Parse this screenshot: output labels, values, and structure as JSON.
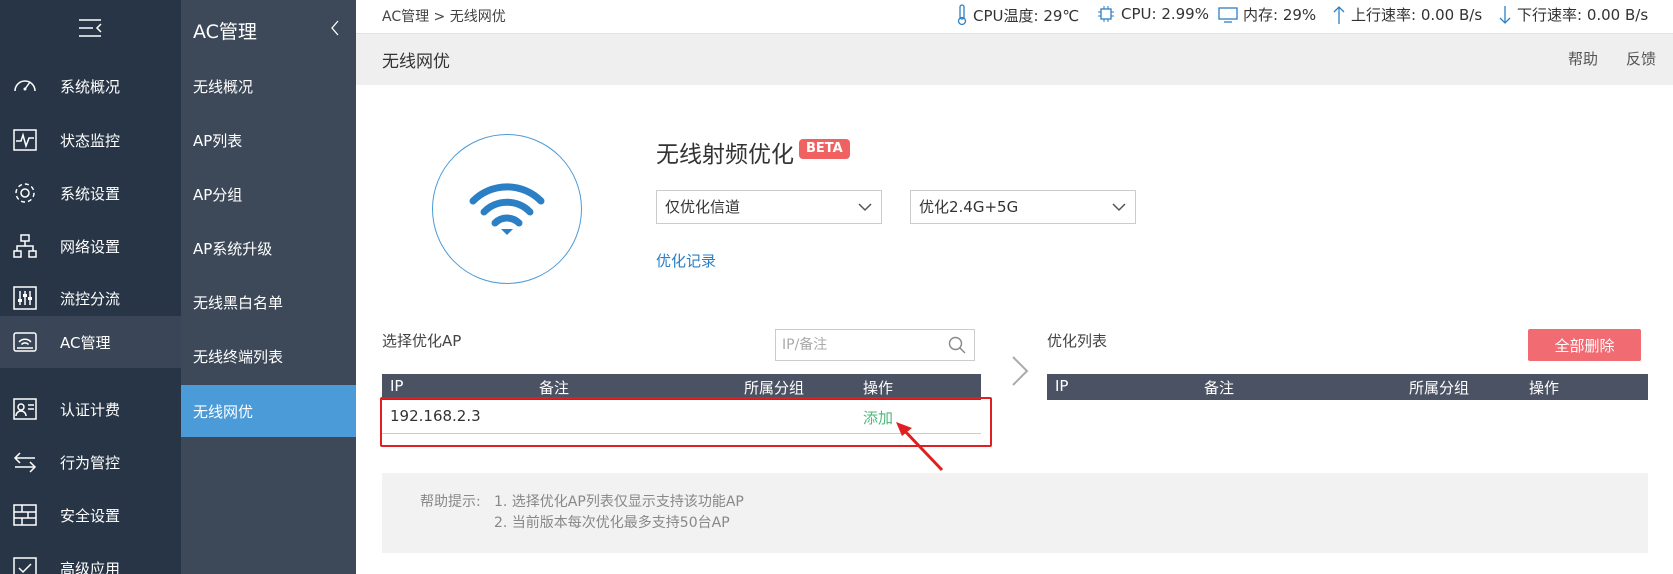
{
  "sidebar": {
    "items": [
      {
        "label": "系统概况",
        "icon": "dashboard-icon"
      },
      {
        "label": "状态监控",
        "icon": "monitor-icon"
      },
      {
        "label": "系统设置",
        "icon": "gear-icon"
      },
      {
        "label": "网络设置",
        "icon": "network-icon"
      },
      {
        "label": "流控分流",
        "icon": "sliders-icon"
      },
      {
        "label": "AC管理",
        "icon": "router-icon"
      },
      {
        "label": "认证计费",
        "icon": "id-card-icon"
      },
      {
        "label": "行为管控",
        "icon": "swap-icon"
      },
      {
        "label": "安全设置",
        "icon": "firewall-icon"
      },
      {
        "label": "高级应用",
        "icon": "check-box-icon"
      }
    ]
  },
  "submenu": {
    "title": "AC管理",
    "items": [
      "无线概况",
      "AP列表",
      "AP分组",
      "AP系统升级",
      "无线黑白名单",
      "无线终端列表",
      "无线网优"
    ]
  },
  "topbar": {
    "breadcrumb": "AC管理 > 无线网优",
    "cpu_temp": "CPU温度: 29℃",
    "cpu": "CPU: 2.99%",
    "memory": "内存: 29%",
    "upload": "上行速率: 0.00 B/s",
    "download": "下行速率: 0.00 B/s"
  },
  "titlebar": {
    "title": "无线网优",
    "help": "帮助",
    "feedback": "反馈"
  },
  "optimize": {
    "title": "无线射频优化",
    "badge": "BETA",
    "mode_select": "仅优化信道",
    "band_select": "优化2.4G+5G",
    "record_link": "优化记录"
  },
  "select_ap": {
    "label": "选择优化AP",
    "search_placeholder": "IP/备注",
    "columns": [
      "IP",
      "备注",
      "所属分组",
      "操作"
    ],
    "rows": [
      {
        "ip": "192.168.2.3",
        "note": "",
        "group": "",
        "action": "添加"
      }
    ]
  },
  "opt_list": {
    "label": "优化列表",
    "delete_all": "全部删除",
    "columns": [
      "IP",
      "备注",
      "所属分组",
      "操作"
    ]
  },
  "help": {
    "label": "帮助提示:",
    "lines": [
      "1. 选择优化AP列表仅显示支持该功能AP",
      "2. 当前版本每次优化最多支持50台AP"
    ]
  },
  "colors": {
    "sidebar_bg": "#273546",
    "submenu_bg": "#3d4959",
    "accent": "#4a9bd8",
    "danger": "#f06b72",
    "link": "#2b7fc5",
    "add_green": "#4cb97a"
  }
}
